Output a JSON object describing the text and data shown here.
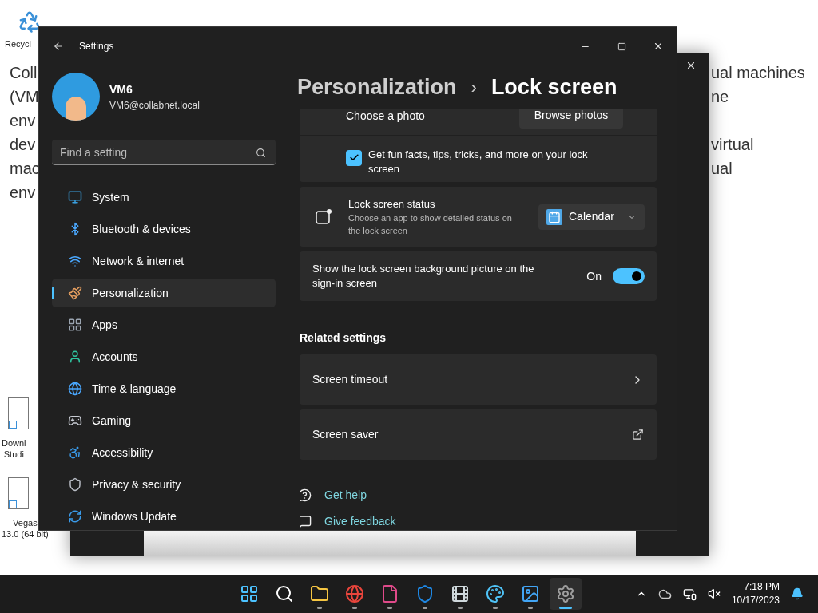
{
  "desktop_icons": [
    {
      "kind": "recycle",
      "lines": [
        "Recycl"
      ]
    },
    {
      "kind": "shortcut",
      "lines": [
        "Downl",
        "Studi"
      ]
    },
    {
      "kind": "shortcut",
      "lines": [
        "Vegas",
        "13.0 (64 bit)"
      ]
    }
  ],
  "background_document": {
    "left": [
      {
        "text": "Coll"
      },
      {
        "text": "(VM"
      },
      {
        "text": "env"
      },
      {
        "text": "dev"
      },
      {
        "text": "mac"
      },
      {
        "text": "env"
      }
    ],
    "right": [
      {
        "lines": [
          "ual machines",
          "ne"
        ]
      },
      {
        "lines": [
          "virtual",
          "ual"
        ]
      }
    ]
  },
  "settings": {
    "title": "Settings",
    "user": {
      "name": "VM6",
      "email": "VM6@collabnet.local"
    },
    "search": {
      "placeholder": "Find a setting"
    },
    "nav": [
      {
        "label": "System",
        "kind": "system",
        "selected": false
      },
      {
        "label": "Bluetooth & devices",
        "kind": "bluetooth",
        "selected": false
      },
      {
        "label": "Network & internet",
        "kind": "network",
        "selected": false
      },
      {
        "label": "Personalization",
        "kind": "personalization",
        "selected": true
      },
      {
        "label": "Apps",
        "kind": "apps",
        "selected": false
      },
      {
        "label": "Accounts",
        "kind": "accounts",
        "selected": false
      },
      {
        "label": "Time & language",
        "kind": "time",
        "selected": false
      },
      {
        "label": "Gaming",
        "kind": "gaming",
        "selected": false
      },
      {
        "label": "Accessibility",
        "kind": "accessibility",
        "selected": false
      },
      {
        "label": "Privacy & security",
        "kind": "privacy",
        "selected": false
      },
      {
        "label": "Windows Update",
        "kind": "update",
        "selected": false
      }
    ],
    "breadcrumb": {
      "parent": "Personalization",
      "separator": "›",
      "current": "Lock screen"
    },
    "choose_photo": {
      "label": "Choose a photo",
      "button": "Browse photos"
    },
    "fun_facts": {
      "label": "Get fun facts, tips, tricks, and more on your lock screen",
      "checked": true
    },
    "status": {
      "title": "Lock screen status",
      "description": "Choose an app to show detailed status on the lock screen",
      "app": "Calendar"
    },
    "signin_picture": {
      "label": "Show the lock screen background picture on the sign-in screen",
      "state_label": "On",
      "on": true
    },
    "related_title": "Related settings",
    "related": [
      {
        "label": "Screen timeout",
        "kind": "chevron"
      },
      {
        "label": "Screen saver",
        "kind": "external"
      }
    ],
    "links": [
      {
        "label": "Get help",
        "kind": "help"
      },
      {
        "label": "Give feedback",
        "kind": "feedback"
      }
    ]
  },
  "taskbar": {
    "apps": [
      {
        "kind": "start",
        "open": false,
        "selected": false
      },
      {
        "kind": "search",
        "open": false,
        "selected": false
      },
      {
        "kind": "explorer",
        "open": true,
        "selected": false
      },
      {
        "kind": "chrome",
        "open": true,
        "selected": false
      },
      {
        "kind": "ds",
        "open": true,
        "selected": false
      },
      {
        "kind": "shield",
        "open": true,
        "selected": false
      },
      {
        "kind": "film",
        "open": true,
        "selected": false
      },
      {
        "kind": "paint",
        "open": true,
        "selected": false
      },
      {
        "kind": "photos",
        "open": true,
        "selected": false
      },
      {
        "kind": "settings",
        "open": true,
        "selected": true
      }
    ],
    "clock": {
      "time": "7:18 PM",
      "date": "10/17/2023"
    }
  }
}
